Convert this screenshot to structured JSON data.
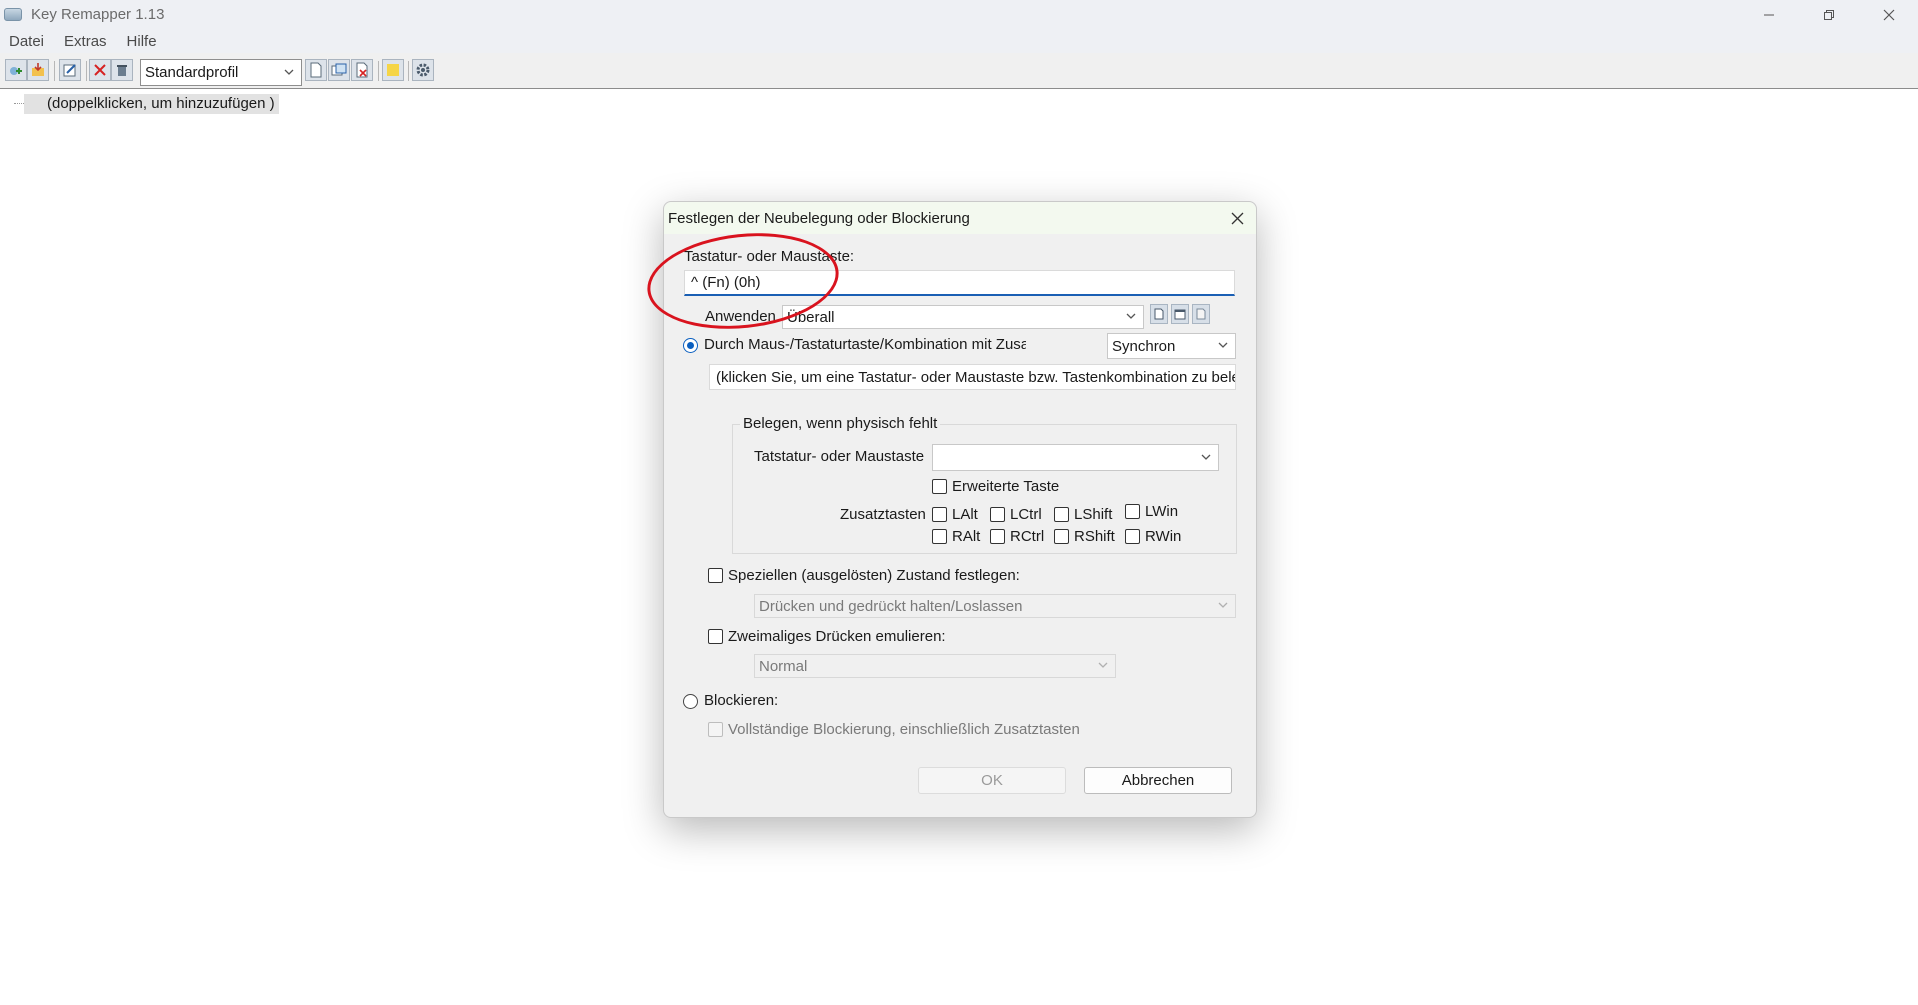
{
  "window": {
    "title": "Key Remapper 1.13",
    "controls": {
      "minimize": "minimize-icon",
      "maximize": "restore-icon",
      "close": "close-icon"
    }
  },
  "menu": {
    "items": [
      "Datei",
      "Extras",
      "Hilfe"
    ]
  },
  "toolbar": {
    "profile": "Standardprofil",
    "icons": [
      "add-icon",
      "import-icon",
      "edit-icon",
      "delete-icon",
      "trash-icon",
      "new-profile-icon",
      "copy-profile-icon",
      "delete-profile-icon",
      "folder-icon",
      "settings-icon"
    ]
  },
  "tree": {
    "placeholder": "(doppelklicken, um hinzuzufügen )"
  },
  "dialog": {
    "title": "Festlegen der Neubelegung oder Blockierung",
    "key_label": "Tastatur- oder Maustaste:",
    "key_value": "^ (Fn) (0h)",
    "apply_label": "Anwenden",
    "apply_value": "Überall",
    "remap_option": "Durch Maus-/Tastaturtaste/Kombination mit Zusatztasten er",
    "sync_value": "Synchron",
    "remap_field": "(klicken Sie, um eine Tastatur- oder Maustaste bzw. Tastenkombination zu bele",
    "physical_group": {
      "title": "Belegen, wenn physisch fehlt",
      "key_label": "Tatstatur- oder Maustaste",
      "key_value": "",
      "extended_label": "Erweiterte Taste",
      "modifiers_label": "Zusatztasten",
      "modifiers": [
        "LAlt",
        "LCtrl",
        "LShift",
        "LWin",
        "RAlt",
        "RCtrl",
        "RShift",
        "RWin"
      ]
    },
    "special_state_label": "Speziellen (ausgelösten) Zustand festlegen:",
    "special_state_value": "Drücken und gedrückt halten/Loslassen",
    "double_press_label": "Zweimaliges Drücken emulieren:",
    "double_press_value": "Normal",
    "block_label": "Blockieren:",
    "full_block_label": "Vollständige Blockierung, einschließlich Zusatztasten",
    "ok": "OK",
    "cancel": "Abbrechen"
  },
  "annotation": {
    "color": "#d9131e"
  },
  "colors": {
    "accent": "#0a5fc0",
    "title_bar": "#eef0f4",
    "dialog_bg": "#f0f0f0"
  }
}
